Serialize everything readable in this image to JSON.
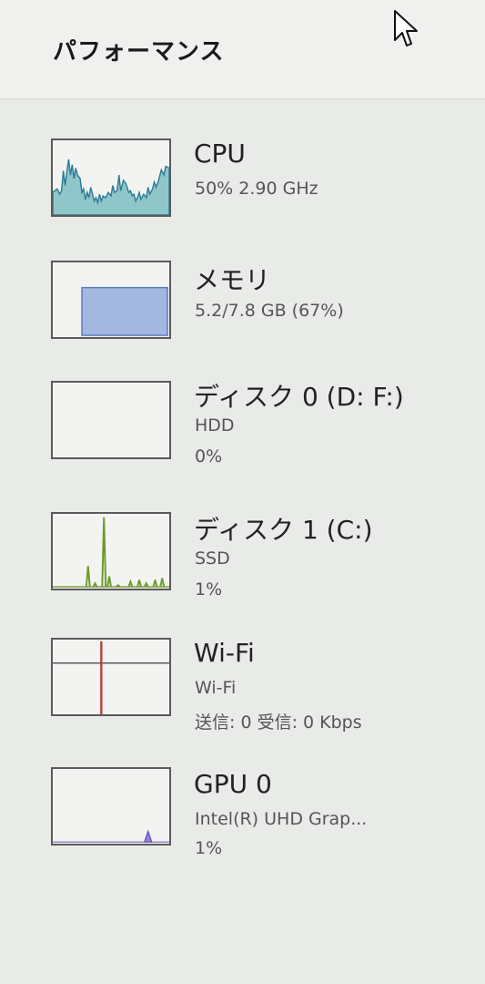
{
  "panel": {
    "title": "パフォーマンス"
  },
  "items": [
    {
      "name": "CPU",
      "line1": "50%  2.90 GHz",
      "line2": "",
      "graph": "cpu",
      "color": "#3f8aa6"
    },
    {
      "name": "メモリ",
      "line1": "5.2/7.8 GB (67%)",
      "line2": "",
      "graph": "memory",
      "color": "#7f9bd1"
    },
    {
      "name": "ディスク 0 (D: F:)",
      "line1": "HDD",
      "line2": "0%",
      "graph": "disk0",
      "color": "#6d9a2c"
    },
    {
      "name": "ディスク 1 (C:)",
      "line1": "SSD",
      "line2": "1%",
      "graph": "disk1",
      "color": "#6d9a2c"
    },
    {
      "name": "Wi-Fi",
      "line1": "Wi-Fi",
      "line2": "送信: 0 受信: 0 Kbps",
      "graph": "wifi",
      "color": "#b3443f"
    },
    {
      "name": "GPU 0",
      "line1": "Intel(R) UHD Grap...",
      "line2": "1%",
      "graph": "gpu",
      "color": "#6b54b8"
    }
  ]
}
